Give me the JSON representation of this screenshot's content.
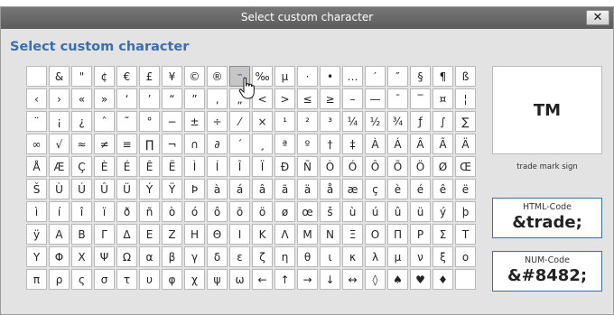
{
  "dialog": {
    "title": "Select custom character",
    "close_glyph": "✕",
    "heading": "Select custom character"
  },
  "characters": [
    "",
    "&",
    "\"",
    "¢",
    "€",
    "£",
    "¥",
    "©",
    "®",
    "™",
    "‰",
    "µ",
    "·",
    "•",
    "…",
    "′",
    "″",
    "§",
    "¶",
    "ß",
    "‹",
    "›",
    "«",
    "»",
    "‘",
    "’",
    "“",
    "”",
    "‚",
    "„",
    "<",
    ">",
    "≤",
    "≥",
    "–",
    "—",
    "¯",
    "‾",
    "¤",
    "¦",
    "¨",
    "¡",
    "¿",
    "ˆ",
    "˜",
    "°",
    "−",
    "±",
    "÷",
    "⁄",
    "×",
    "¹",
    "²",
    "³",
    "¼",
    "½",
    "¾",
    "ƒ",
    "∫",
    "∑",
    "∞",
    "√",
    "≈",
    "≠",
    "≡",
    "∏",
    "¬",
    "∩",
    "∂",
    "´",
    "¸",
    "ª",
    "º",
    "†",
    "‡",
    "À",
    "Á",
    "Â",
    "Ã",
    "Ä",
    "Å",
    "Æ",
    "Ç",
    "È",
    "É",
    "Ê",
    "Ë",
    "Ì",
    "Í",
    "Î",
    "Ï",
    "Ð",
    "Ñ",
    "Ò",
    "Ó",
    "Ô",
    "Õ",
    "Ö",
    "Ø",
    "Œ",
    "Š",
    "Ù",
    "Ú",
    "Û",
    "Ü",
    "Ý",
    "Ÿ",
    "Þ",
    "à",
    "á",
    "â",
    "ã",
    "ä",
    "å",
    "æ",
    "ç",
    "è",
    "é",
    "ê",
    "ë",
    "ì",
    "í",
    "î",
    "ï",
    "ð",
    "ñ",
    "ò",
    "ó",
    "ô",
    "õ",
    "ö",
    "ø",
    "œ",
    "š",
    "ù",
    "ú",
    "û",
    "ü",
    "ý",
    "þ",
    "ÿ",
    "Α",
    "Β",
    "Γ",
    "Δ",
    "Ε",
    "Ζ",
    "Η",
    "Θ",
    "Ι",
    "Κ",
    "Λ",
    "Μ",
    "Ν",
    "Ξ",
    "Ο",
    "Π",
    "Ρ",
    "Σ",
    "Τ",
    "Υ",
    "Φ",
    "Χ",
    "Ψ",
    "Ω",
    "α",
    "β",
    "γ",
    "δ",
    "ε",
    "ζ",
    "η",
    "θ",
    "ι",
    "κ",
    "λ",
    "μ",
    "ν",
    "ξ",
    "ο",
    "π",
    "ρ",
    "ς",
    "σ",
    "τ",
    "υ",
    "φ",
    "χ",
    "ψ",
    "ω",
    "←",
    "↑",
    "→",
    "↓",
    "↔",
    "◊",
    "♠",
    "♥",
    "♦",
    ""
  ],
  "selected_index": 9,
  "preview": {
    "glyph": "TM",
    "name": "trade mark sign",
    "html_label": "HTML-Code",
    "html_value": "&trade;",
    "num_label": "NUM-Code",
    "num_value": "&#8482;"
  },
  "colors": {
    "accent": "#3d6cb0",
    "titlebar": "#6a6a6a",
    "dialog_bg": "#e3e3e3",
    "selected_cell": "#c6c6c6"
  },
  "cursor_icon": "hand-pointer-icon"
}
